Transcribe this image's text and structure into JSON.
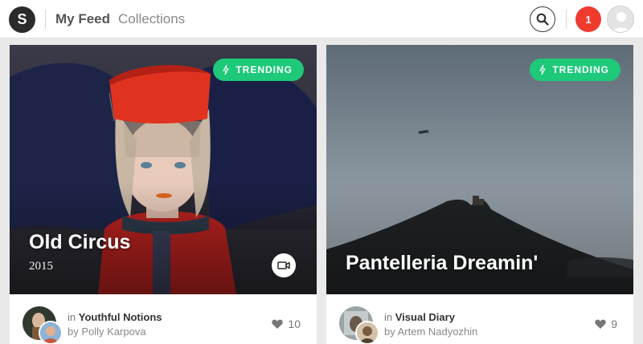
{
  "app": {
    "logo_letter": "S"
  },
  "nav": {
    "feed_label": "My Feed",
    "collections_label": "Collections"
  },
  "header": {
    "notification_count": "1",
    "icons": {
      "search": "search-icon",
      "profile": "user-avatar"
    }
  },
  "colors": {
    "trending_green": "#1ec97a",
    "notification_red": "#ee3b2e",
    "logo_dark": "#2b2b2b"
  },
  "cards": [
    {
      "badge": "TRENDING",
      "title": "Old Circus",
      "year": "2015",
      "has_video": true,
      "in_prefix": "in",
      "collection": "Youthful Notions",
      "by_prefix": "by",
      "author": "Polly Karpova",
      "likes": "10"
    },
    {
      "badge": "TRENDING",
      "title": "Pantelleria Dreamin'",
      "in_prefix": "in",
      "collection": "Visual Diary",
      "by_prefix": "by",
      "author": "Artem Nadyozhin",
      "likes": "9"
    }
  ]
}
